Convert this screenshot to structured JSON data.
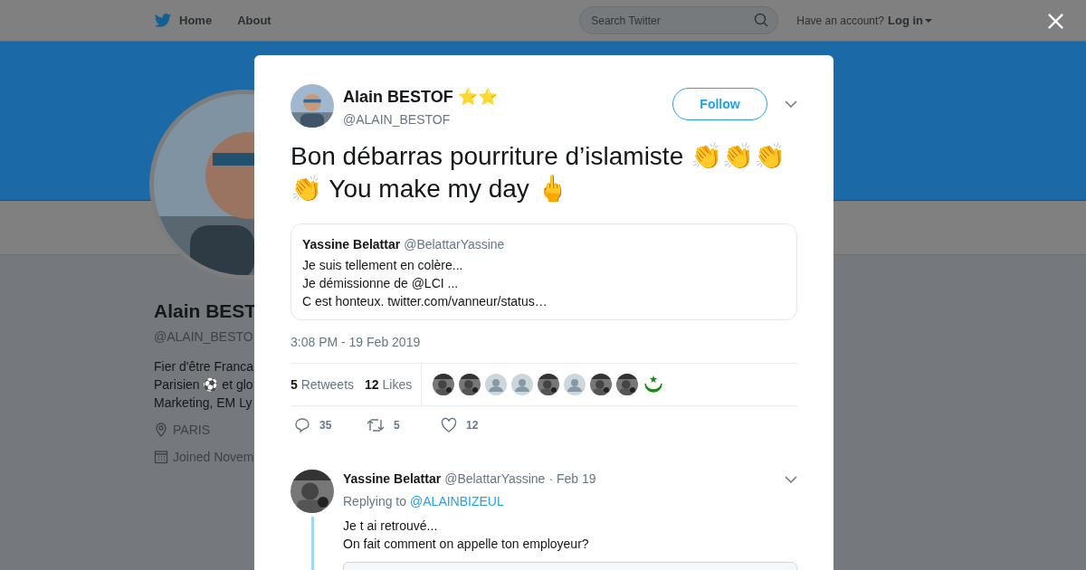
{
  "topbar": {
    "home": "Home",
    "about": "About",
    "search_placeholder": "Search Twitter",
    "account_prompt": "Have an account?",
    "login": "Log in"
  },
  "profile": {
    "name": "Alain BEST",
    "handle": "@ALAIN_BESTO",
    "bio": [
      "Fier d'être Franca",
      "Parisien ⚽ et glo",
      "Marketing, EM Ly"
    ],
    "location": "PARIS",
    "joined": "Joined Novem"
  },
  "tweet": {
    "name": "Alain BESTOF ⭐⭐",
    "handle": "@ALAIN_BESTOF",
    "follow": "Follow",
    "text": "Bon débarras pourriture d’islamiste 👏👏👏👏 You make my day 🖕",
    "quote": {
      "name": "Yassine Belattar",
      "handle": "@BelattarYassine",
      "lines": [
        "Je suis tellement en colère...",
        "Je démissionne de @LCI ...",
        "C est honteux. twitter.com/vanneur/status…"
      ]
    },
    "time": "3:08 PM - 19 Feb 2019",
    "stats": [
      {
        "count": "5",
        "label": "Retweets"
      },
      {
        "count": "12",
        "label": "Likes"
      }
    ],
    "likers": [
      {
        "kind": "picture"
      },
      {
        "kind": "picture"
      },
      {
        "kind": "default"
      },
      {
        "kind": "default"
      },
      {
        "kind": "picture"
      },
      {
        "kind": "default"
      },
      {
        "kind": "picture"
      },
      {
        "kind": "picture"
      },
      {
        "kind": "crescent"
      }
    ],
    "actions": [
      {
        "kind": "reply",
        "count": "35"
      },
      {
        "kind": "retweet",
        "count": "5"
      },
      {
        "kind": "like",
        "count": "12"
      }
    ]
  },
  "reply": {
    "name": "Yassine Belattar",
    "handle": "@BelattarYassine",
    "date": "· Feb 19",
    "replying_to": "Replying to",
    "mention": "@ALAINBIZEUL",
    "lines": [
      "Je t ai retrouvé...",
      "On fait comment on appelle ton employeur?"
    ]
  }
}
